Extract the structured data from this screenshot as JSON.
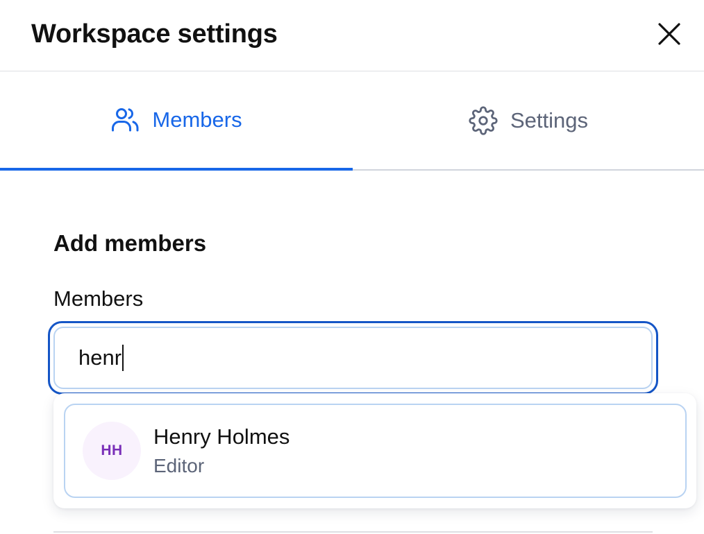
{
  "dialog": {
    "title": "Workspace settings",
    "close_icon": "close-icon"
  },
  "tabs": [
    {
      "label": "Members",
      "icon": "users-icon",
      "active": true
    },
    {
      "label": "Settings",
      "icon": "gear-icon",
      "active": false
    }
  ],
  "colors": {
    "accent": "#1867e8",
    "inactive_tab": "#5c6478",
    "avatar_bg": "#f9f2fd",
    "avatar_text": "#7a2fb8"
  },
  "add_members": {
    "heading": "Add members",
    "field_label": "Members",
    "input_value": "henr"
  },
  "suggestions": [
    {
      "initials": "HH",
      "name": "Henry Holmes",
      "role": "Editor"
    }
  ]
}
